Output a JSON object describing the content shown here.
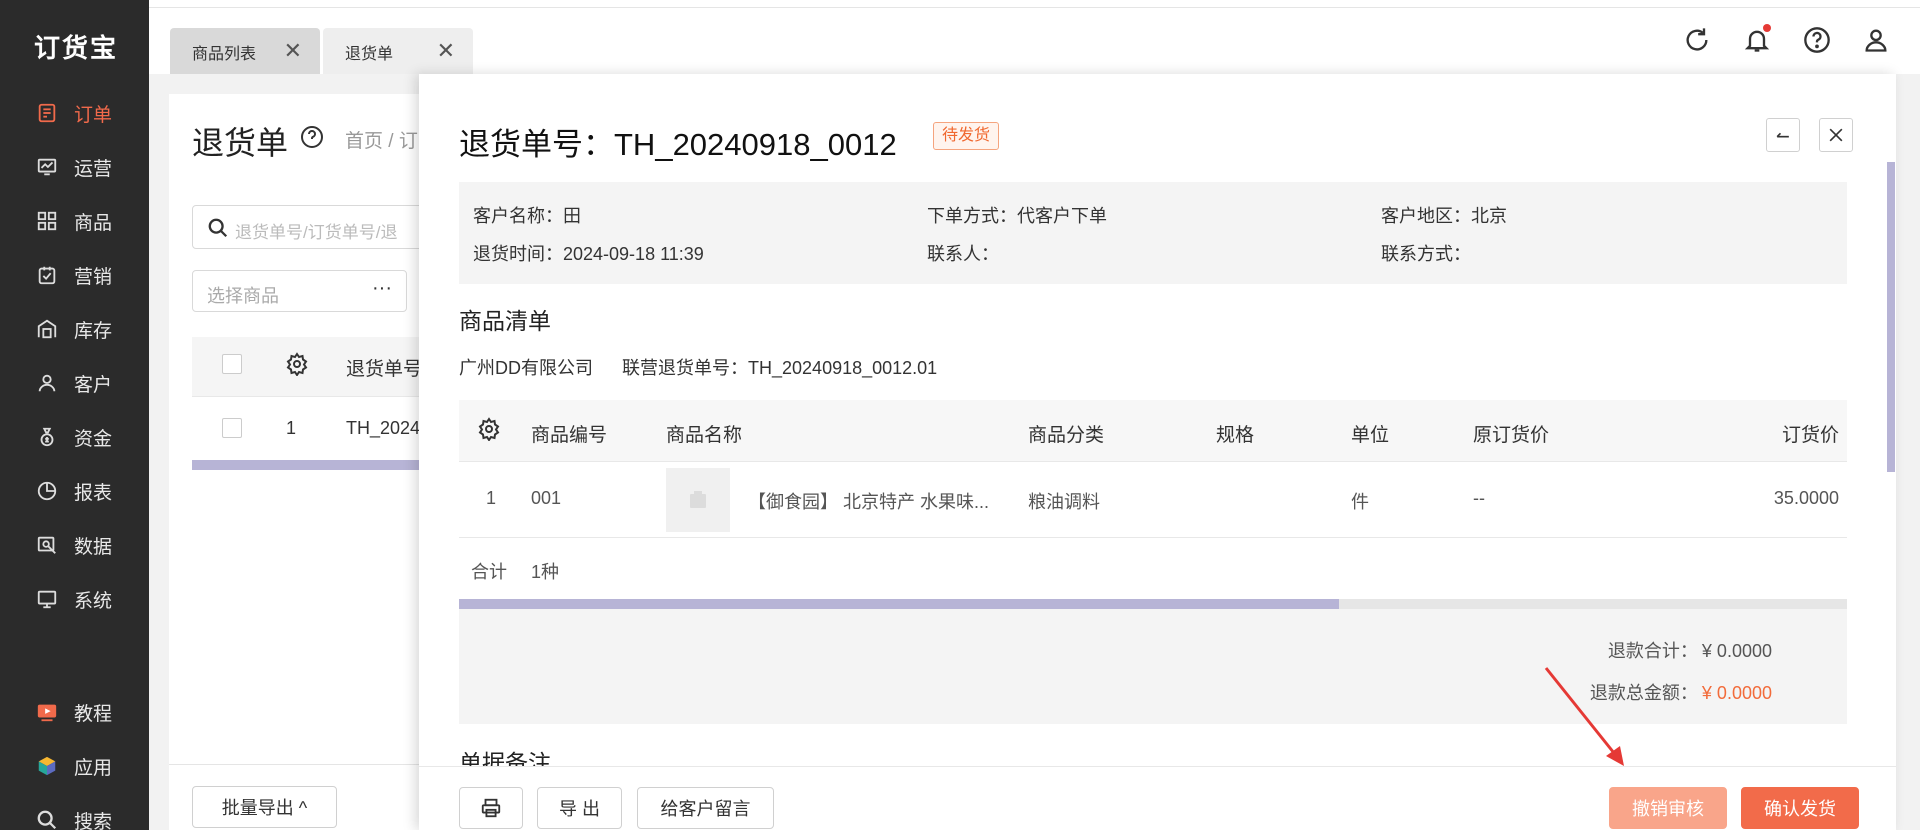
{
  "app": {
    "logo": "订货宝"
  },
  "sidebar": {
    "items": [
      {
        "label": "订单",
        "icon": "order-icon"
      },
      {
        "label": "运营",
        "icon": "operation-icon"
      },
      {
        "label": "商品",
        "icon": "product-icon"
      },
      {
        "label": "营销",
        "icon": "marketing-icon"
      },
      {
        "label": "库存",
        "icon": "inventory-icon"
      },
      {
        "label": "客户",
        "icon": "customer-icon"
      },
      {
        "label": "资金",
        "icon": "funds-icon"
      },
      {
        "label": "报表",
        "icon": "report-icon"
      },
      {
        "label": "数据",
        "icon": "data-icon"
      },
      {
        "label": "系统",
        "icon": "system-icon"
      }
    ],
    "bottom": [
      {
        "label": "教程",
        "icon": "tutorial-icon"
      },
      {
        "label": "应用",
        "icon": "apps-icon"
      },
      {
        "label": "搜索",
        "icon": "search-icon"
      }
    ],
    "active_color": "#f16a4b"
  },
  "tabs": [
    {
      "label": "商品列表"
    },
    {
      "label": "退货单"
    }
  ],
  "background_page": {
    "title": "退货单",
    "breadcrumb": "首页 / 订",
    "search_placeholder": "退货单号/订货单号/退",
    "select_placeholder": "选择商品",
    "select_more": "···",
    "col_header": "退货单号",
    "row": {
      "index": "1",
      "id": "TH_2024"
    },
    "export_button": "批量导出 ^"
  },
  "drawer": {
    "title": "退货单号：TH_20240918_0012",
    "status": "待发货",
    "info": {
      "customer_name": "客户名称：田",
      "order_method": "下单方式：代客户下单",
      "customer_region": "客户地区：北京",
      "return_time": "退货时间：2024-09-18 11:39",
      "contact": "联系人：",
      "contact_method": "联系方式："
    },
    "goods_section_title": "商品清单",
    "supplier": "广州DD有限公司",
    "joint_return_no": "联营退货单号：TH_20240918_0012.01",
    "table": {
      "headers": [
        "商品编号",
        "商品名称",
        "商品分类",
        "规格",
        "单位",
        "原订货价",
        "订货价"
      ],
      "rows": [
        {
          "index": "1",
          "code": "001",
          "name": "【御食园】 北京特产 水果味...",
          "category": "粮油调料",
          "spec": "",
          "unit": "件",
          "orig_price": "--",
          "price": "35.0000"
        }
      ],
      "summary_label": "合计",
      "summary_value": "1种"
    },
    "totals": {
      "refund_subtotal_label": "退款合计：",
      "refund_subtotal_value": "¥ 0.0000",
      "refund_total_label": "退款总金额：",
      "refund_total_value": "¥ 0.0000"
    },
    "remarks_title": "单据备注",
    "footer": {
      "export_label": "导 出",
      "message_label": "给客户留言",
      "revoke_label": "撤销审核",
      "confirm_label": "确认发货"
    }
  },
  "colors": {
    "accent": "#f26b4a",
    "status": "#f0682f",
    "scrollbar": "#b7b4d6",
    "sidebar_bg": "#2b2b2b"
  }
}
